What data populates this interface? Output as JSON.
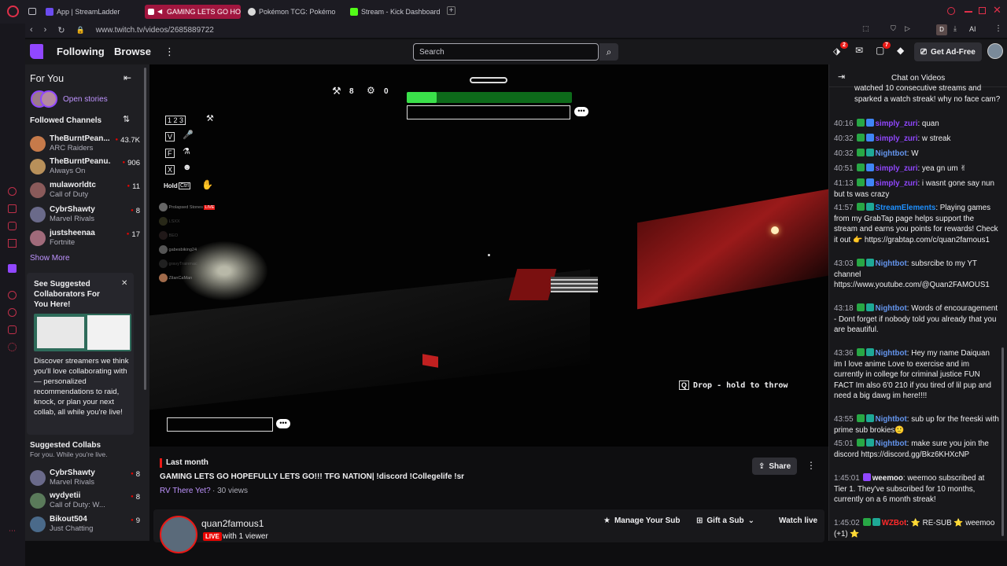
{
  "browser": {
    "tabs": [
      {
        "label": "App | StreamLadder",
        "color": "#6b4cf0"
      },
      {
        "label": "GAMING LETS GO HO",
        "color": "#ffffff",
        "active": true
      },
      {
        "label": "Pokémon TCG: Pokémon",
        "color": "#d9d9d9"
      },
      {
        "label": "Stream - Kick Dashboard",
        "color": "#53fc18"
      }
    ],
    "url": "www.twitch.tv/videos/2685889722",
    "profile_letter": "D",
    "ai_label": "AI"
  },
  "topnav": {
    "following": "Following",
    "browse": "Browse",
    "search_placeholder": "Search",
    "notif_badge_1": "2",
    "notif_badge_2": "7",
    "get_ad_free": "Get Ad-Free"
  },
  "sidebar": {
    "for_you": "For You",
    "open_stories": "Open stories",
    "followed_channels": "Followed Channels",
    "channels": [
      {
        "name": "TheBurntPean...",
        "game": "ARC Raiders",
        "viewers": "43.7K",
        "color": "#c67a4a"
      },
      {
        "name": "TheBurntPeanu...",
        "game": "Always On",
        "viewers": "906",
        "color": "#b8905a"
      },
      {
        "name": "mulaworldtc",
        "game": "Call of Duty",
        "viewers": "11",
        "color": "#8a5a5a"
      },
      {
        "name": "CybrShawty",
        "game": "Marvel Rivals",
        "viewers": "8",
        "color": "#6a6a8a"
      },
      {
        "name": "justsheenaa",
        "game": "Fortnite",
        "viewers": "17",
        "color": "#a06a7a"
      }
    ],
    "show_more": "Show More",
    "suggest_title": "See Suggested Collaborators For You Here!",
    "suggest_body": "Discover streamers we think you'll love collaborating with — personalized recommendations to raid, knock, or plan your next collab, all while you're live!",
    "suggested_collabs": "Suggested Collabs",
    "collabs_sub": "For you. While you're live.",
    "collabs": [
      {
        "name": "CybrShawty",
        "game": "Marvel Rivals",
        "viewers": "8",
        "color": "#6a6a8a"
      },
      {
        "name": "wydyetii",
        "game": "Call of Duty: W...",
        "viewers": "8",
        "color": "#5a7a5a"
      },
      {
        "name": "Bikout504",
        "game": "Just Chatting",
        "viewers": "9",
        "color": "#4a6a8a"
      }
    ]
  },
  "video": {
    "hud_count_1": "8",
    "hud_count_2": "0",
    "keys": [
      {
        "keys": "1 2 3",
        "icon": "⚒"
      },
      {
        "keys": "V",
        "icon": "🎤"
      },
      {
        "keys": "F",
        "icon": "⚗"
      },
      {
        "keys": "X",
        "icon": "☻"
      }
    ],
    "hold_label": "Hold",
    "hold_key": "Ctrl",
    "hold_icon": "✋",
    "player_list": [
      {
        "name": "Prolapsed Stones",
        "tag": "LIVE"
      },
      {
        "name": "LSXX",
        "tag": ""
      },
      {
        "name": "BEO",
        "tag": ""
      },
      {
        "name": "gabesbiking24",
        "tag": ""
      },
      {
        "name": "gravyTrainmac",
        "tag": ""
      },
      {
        "name": "ZilanCaMan",
        "tag": ""
      }
    ],
    "drop_hint": "Drop - hold to throw",
    "key_q": "Q"
  },
  "info": {
    "when": "Last month",
    "title": "GAMING LETS GO HOPEFULLY LETS GO!!! TFG NATION| !discord !Collegelife !sr",
    "game": "RV There Yet?",
    "views": "· 30 views",
    "share": "Share",
    "channel": "quan2famous1",
    "live": "LIVE",
    "viewers": "with 1 viewer",
    "manage_sub": "Manage Your Sub",
    "gift_sub": "Gift a Sub",
    "watch_live": "Watch live"
  },
  "chat": {
    "title": "Chat on Videos",
    "messages": [
      {
        "ts": "",
        "name": "",
        "color": "#efeff1",
        "text": "watched 10 consecutive streams and sparked a watch streak! why no face cam?",
        "badges": []
      },
      {
        "ts": "40:16",
        "name": "simply_zuri",
        "color": "#9147ff",
        "text": "quan",
        "badges": [
          "#28a745",
          "#3f85f5"
        ]
      },
      {
        "ts": "40:32",
        "name": "simply_zuri",
        "color": "#9147ff",
        "text": "w streak",
        "badges": [
          "#28a745",
          "#3f85f5"
        ]
      },
      {
        "ts": "40:32",
        "name": "Nightbot",
        "color": "#6495ed",
        "text": "W",
        "badges": [
          "#28a745",
          "#1ea896"
        ]
      },
      {
        "ts": "40:51",
        "name": "simply_zuri",
        "color": "#9147ff",
        "text": "yea gn um ✌",
        "badges": [
          "#28a745",
          "#3f85f5"
        ]
      },
      {
        "ts": "41:13",
        "name": "simply_zuri",
        "color": "#9147ff",
        "text": "i wasnt gone say nun but ts was crazy",
        "badges": [
          "#28a745",
          "#3f85f5"
        ]
      },
      {
        "ts": "41:57",
        "name": "StreamElements",
        "color": "#1e90ff",
        "text": "Playing games from my GrabTap page helps support the stream and earns you points for rewards! Check it out 👉 https://grabtap.com/c/quan2famous1",
        "badges": [
          "#28a745",
          "#1ea896"
        ]
      },
      {
        "ts": "43:03",
        "name": "Nightbot",
        "color": "#6495ed",
        "text": "subsrcibe to my YT channel https://www.youtube.com/@Quan2FAMOUS1",
        "badges": [
          "#28a745",
          "#1ea896"
        ]
      },
      {
        "ts": "43:18",
        "name": "Nightbot",
        "color": "#6495ed",
        "text": "Words of encouragement - Dont forget if nobody told you already that you are beautiful.",
        "badges": [
          "#28a745",
          "#1ea896"
        ]
      },
      {
        "ts": "43:36",
        "name": "Nightbot",
        "color": "#6495ed",
        "text": "Hey my name Daiquan im I love anime Love to exercise and im currently in college for criminal justice FUN FACT Im also 6'0 210 if you tired of lil pup and need a big dawg im here!!!!",
        "badges": [
          "#28a745",
          "#1ea896"
        ]
      },
      {
        "ts": "43:55",
        "name": "Nightbot",
        "color": "#6495ed",
        "text": "sub up for the freeski with prime sub brokies🙂",
        "badges": [
          "#28a745",
          "#1ea896"
        ]
      },
      {
        "ts": "45:01",
        "name": "Nightbot",
        "color": "#6495ed",
        "text": "make sure you join the discord https://discord.gg/Bkz6KHXcNP",
        "badges": [
          "#28a745",
          "#1ea896"
        ]
      },
      {
        "ts": "1:45:01",
        "name": "weemoo",
        "color": "#efeff1",
        "text": "weemoo subscribed at Tier 1. They've subscribed for 10 months, currently on a 6 month streak!",
        "badges": [
          "#9147ff"
        ]
      },
      {
        "ts": "1:45:02",
        "name": "WZBot",
        "color": "#ff2a2a",
        "text": "⭐ RE-SUB ⭐ weemoo (+1) ⭐",
        "badges": [
          "#28a745",
          "#1ea896"
        ]
      }
    ]
  },
  "colors": {
    "twitch_purple": "#9147ff",
    "live_red": "#eb0400",
    "accent_tab": "#a1163f"
  }
}
